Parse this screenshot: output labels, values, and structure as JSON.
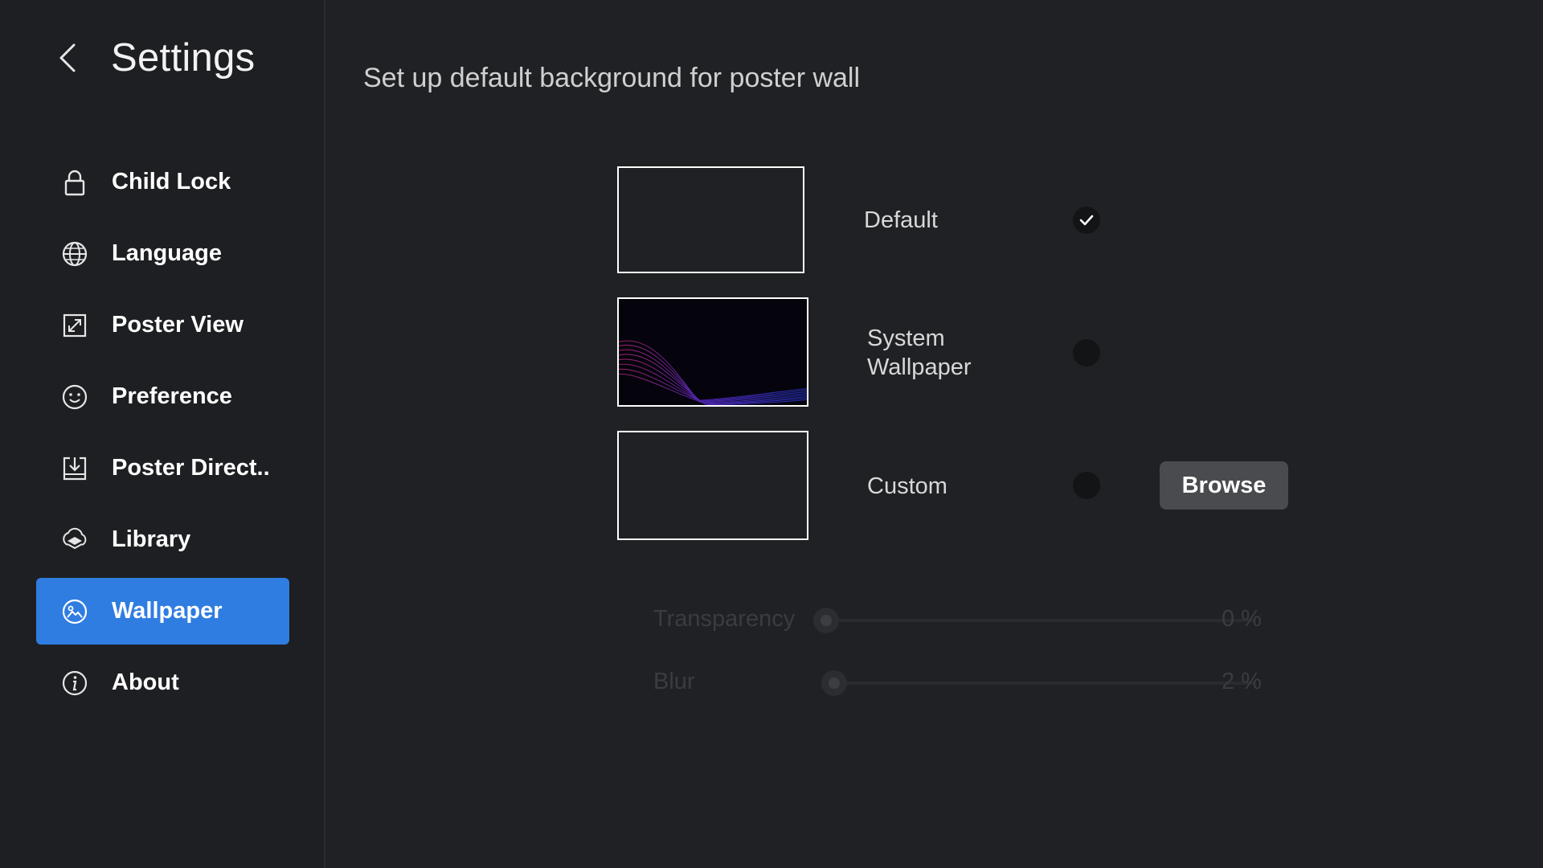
{
  "sidebar": {
    "title": "Settings",
    "back_icon": "chevron-left-icon",
    "items": [
      {
        "label": "Child Lock",
        "icon": "lock-icon"
      },
      {
        "label": "Language",
        "icon": "globe-icon"
      },
      {
        "label": "Poster View",
        "icon": "expand-icon"
      },
      {
        "label": "Preference",
        "icon": "smiley-icon"
      },
      {
        "label": "Poster Direct..",
        "icon": "download-folder-icon"
      },
      {
        "label": "Library",
        "icon": "layers-icon"
      },
      {
        "label": "Wallpaper",
        "icon": "image-icon",
        "active": true
      },
      {
        "label": "About",
        "icon": "info-icon"
      }
    ]
  },
  "main": {
    "heading": "Set up default background for poster wall",
    "options": {
      "default": {
        "label": "Default",
        "selected": true
      },
      "system": {
        "label_line1": "System",
        "label_line2": "Wallpaper",
        "selected": false
      },
      "custom": {
        "label": "Custom",
        "selected": false,
        "browse_label": "Browse"
      }
    },
    "sliders": {
      "transparency": {
        "label": "Transparency",
        "value": 0,
        "value_text": "0 %"
      },
      "blur": {
        "label": "Blur",
        "value": 2,
        "value_text": "2 %"
      }
    }
  },
  "colors": {
    "background": "#202124",
    "sidebar_active": "#2f7de1",
    "browse_button": "#4a4b4f"
  }
}
